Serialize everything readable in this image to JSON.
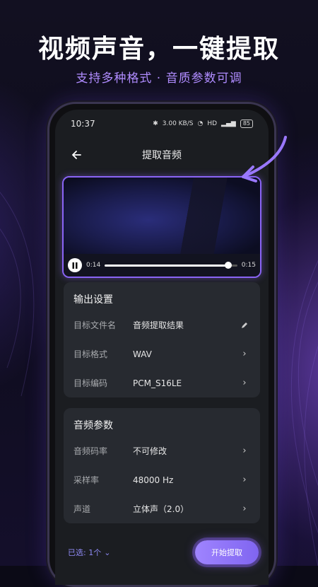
{
  "headline": "视频声音，一键提取",
  "subline": "支持多种格式 · 音质参数可调",
  "status": {
    "time": "10:37",
    "speed": "3.00 KB/S",
    "network": "HD",
    "battery": "85"
  },
  "appbar": {
    "title": "提取音频"
  },
  "player": {
    "current": "0:14",
    "total": "0:15",
    "progress": 0.93
  },
  "output": {
    "title": "输出设置",
    "rows": [
      {
        "label": "目标文件名",
        "value": "音频提取结果",
        "action": "edit-icon"
      },
      {
        "label": "目标格式",
        "value": "WAV",
        "action": "chevron-right-icon"
      },
      {
        "label": "目标编码",
        "value": "PCM_S16LE",
        "action": "chevron-right-icon"
      }
    ]
  },
  "audio": {
    "title": "音频参数",
    "rows": [
      {
        "label": "音频码率",
        "value": "不可修改",
        "action": "chevron-right-icon"
      },
      {
        "label": "采样率",
        "value": "48000 Hz",
        "action": "chevron-right-icon"
      },
      {
        "label": "声道",
        "value": "立体声（2.0）",
        "action": "chevron-right-icon"
      }
    ]
  },
  "footer": {
    "selected": "已选: 1个",
    "start": "开始提取"
  },
  "colors": {
    "accent": "#8a64f5",
    "subline": "#b08cff"
  }
}
